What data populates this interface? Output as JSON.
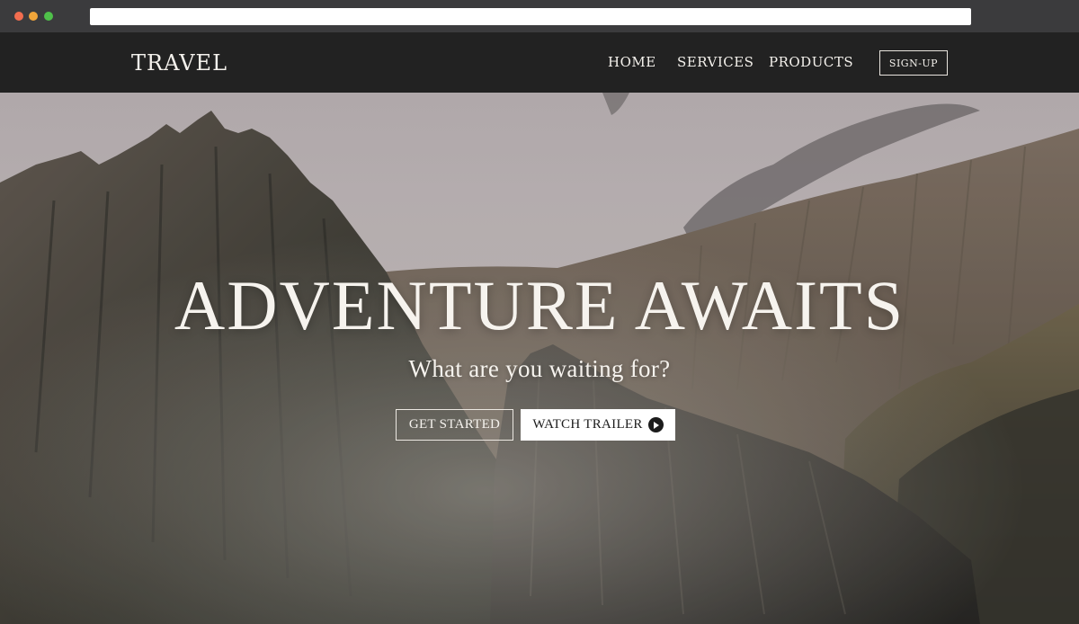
{
  "browser": {
    "window_controls": [
      "close",
      "minimize",
      "maximize"
    ],
    "colors": {
      "close": "#f26d4f",
      "minimize": "#f0a53a",
      "maximize": "#4fc04a"
    }
  },
  "nav": {
    "brand": "TRAVEL",
    "links": [
      "HOME",
      "SERVICES",
      "PRODUCTS"
    ],
    "signup_label": "SIGN-UP"
  },
  "hero": {
    "title": "ADVENTURE AWAITS",
    "subtitle": "What are you waiting for?",
    "primary_button": "GET STARTED",
    "secondary_button": "WATCH TRAILER",
    "secondary_icon": "play-circle-icon",
    "background": "mountain landscape photo"
  },
  "colors": {
    "navbar": "#222222",
    "hero_text": "#f6f3ee",
    "button_white": "#ffffff"
  }
}
